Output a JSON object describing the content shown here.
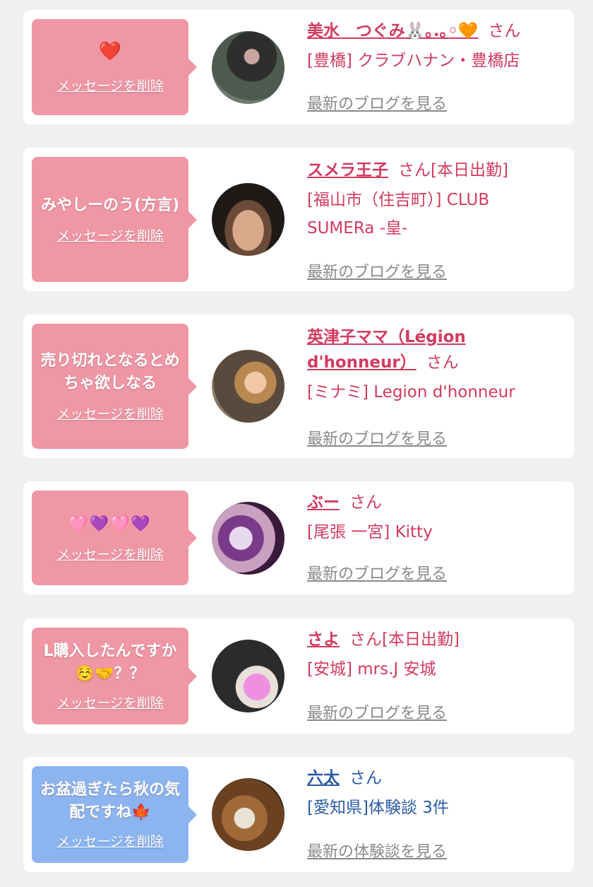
{
  "items": [
    {
      "message": "❤️",
      "delete_label": "メッセージを削除",
      "name": "美水　つぐみ🐰｡.｡◦🧡",
      "honorific": "さん",
      "shop": "[豊橋] クラブハナン・豊橋店",
      "blog_link": "最新のブログを見る"
    },
    {
      "message": "みやしーのう(方言)",
      "delete_label": "メッセージを削除",
      "name": "スメラ王子",
      "honorific": "さん[本日出勤]",
      "shop": "[福山市（住吉町）] CLUB SUMERa -皇-",
      "blog_link": "最新のブログを見る"
    },
    {
      "message": "売り切れとなるとめちゃ欲しなる",
      "delete_label": "メッセージを削除",
      "name": "英津子ママ（Légion d'honneur）",
      "honorific": "さん",
      "shop": "[ミナミ] Legion d'honneur",
      "blog_link": "最新のブログを見る"
    },
    {
      "message": "🩷💜🩷💜",
      "delete_label": "メッセージを削除",
      "name": "ぶー",
      "honorific": "さん",
      "shop": "[尾張 一宮] Kitty",
      "blog_link": "最新のブログを見る"
    },
    {
      "message": "L購入したんですか☺️🤝？？",
      "delete_label": "メッセージを削除",
      "name": "さよ",
      "honorific": "さん[本日出勤]",
      "shop": "[安城] mrs.J 安城",
      "blog_link": "最新のブログを見る"
    },
    {
      "message": "お盆過ぎたら秋の気配ですね🍁",
      "delete_label": "メッセージを削除",
      "name": "六太",
      "honorific": "さん",
      "shop": "[愛知県]体験談 3件",
      "blog_link": "最新の体験談を見る"
    }
  ],
  "colors": {
    "pink_bubble": "#ef97a5",
    "blue_bubble": "#8cb5f0",
    "pink_text": "#d23b5f",
    "blue_text": "#2a5aa6"
  }
}
